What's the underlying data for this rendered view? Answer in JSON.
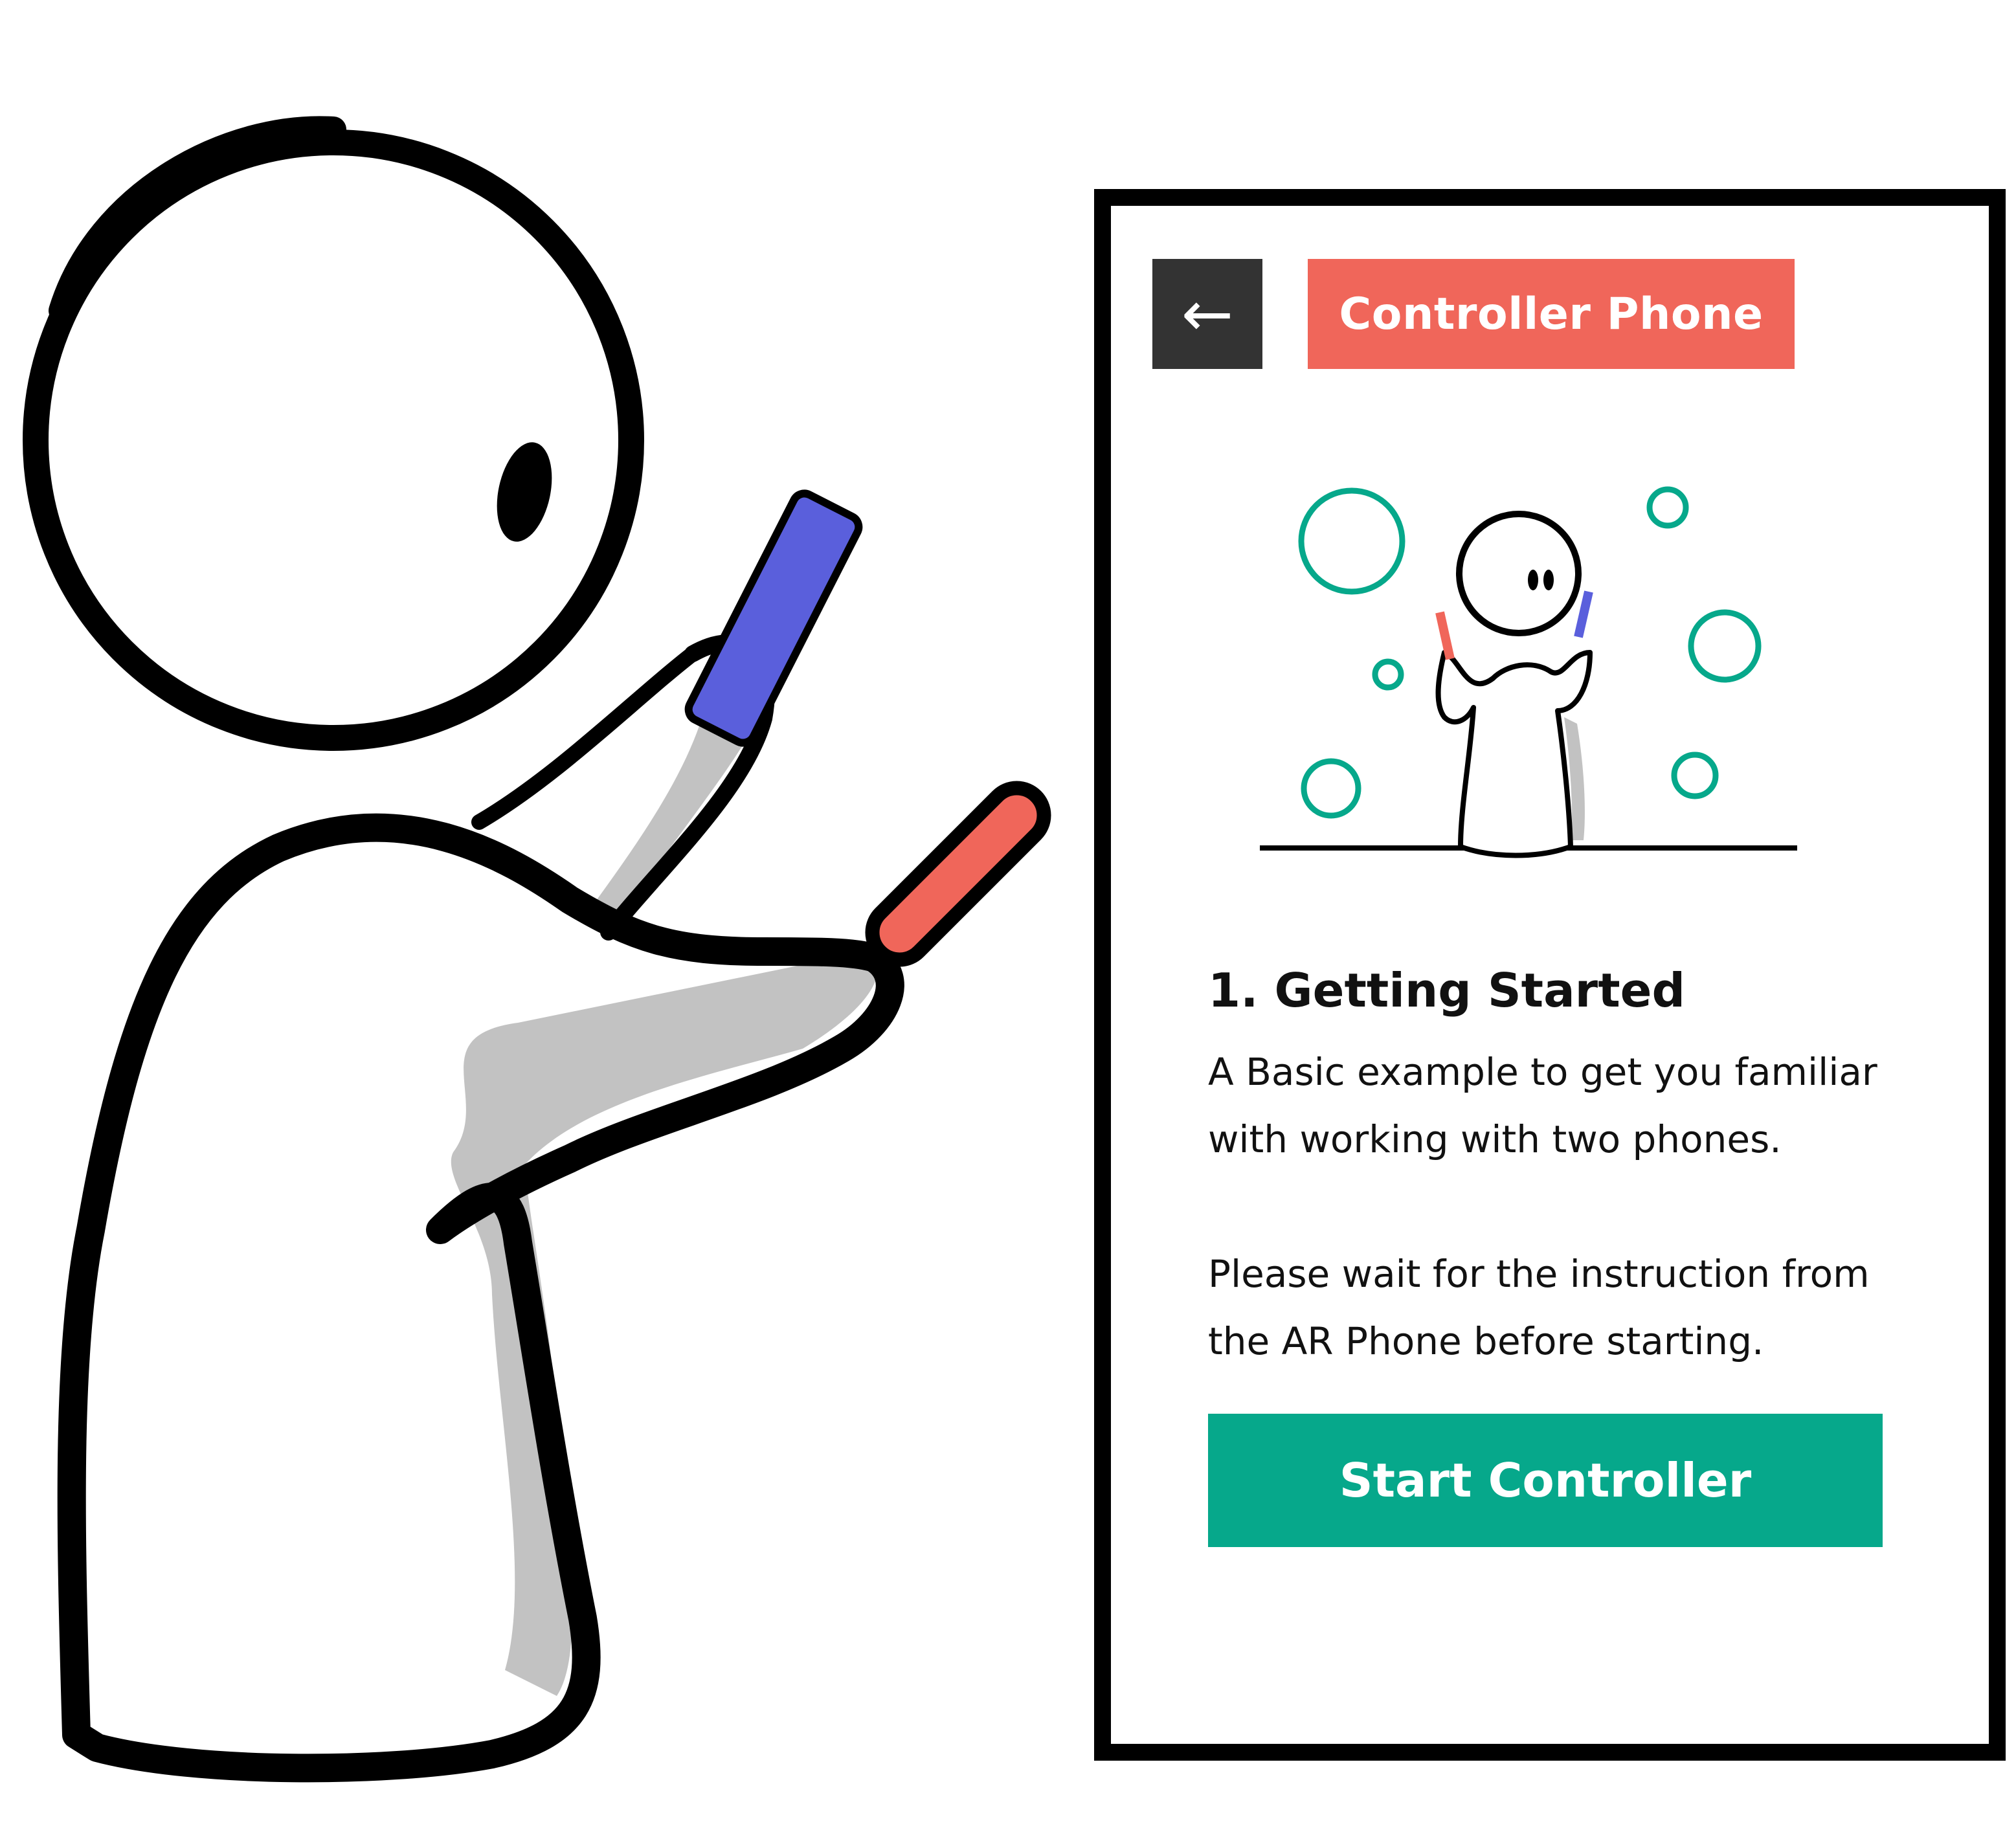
{
  "header": {
    "back_icon": "←",
    "title": "Controller Phone"
  },
  "content": {
    "heading": "1. Getting Started",
    "description": "A Basic example to get you familiar with working with two phones.",
    "instruction": "Please wait for the instruction from the AR Phone before starting."
  },
  "actions": {
    "start_label": "Start Controller"
  },
  "colors": {
    "accent_red": "#f0665a",
    "accent_green": "#06a88b",
    "phone_blue": "#5a5fdc",
    "dark": "#333333"
  },
  "icons": {
    "back": "left-arrow-icon"
  }
}
